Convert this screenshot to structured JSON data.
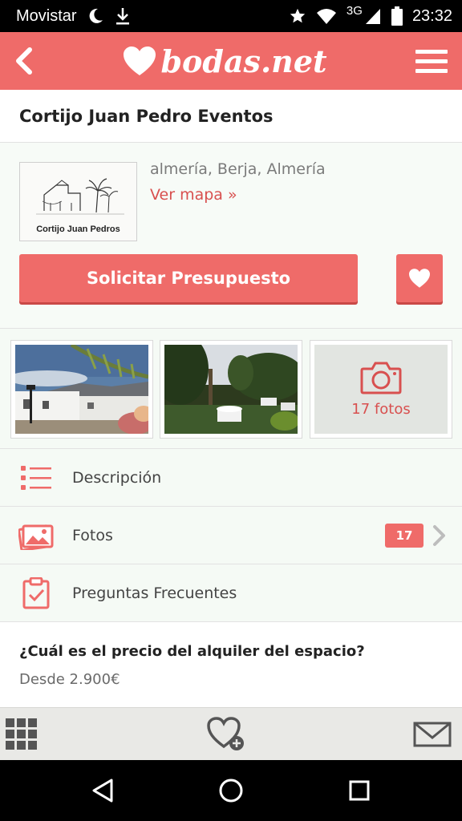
{
  "status_bar": {
    "carrier": "Movistar",
    "network": "3G",
    "time": "23:32",
    "icons": [
      "moon-icon",
      "download-icon",
      "star-icon",
      "wifi-icon",
      "signal-icon",
      "battery-icon"
    ]
  },
  "app_bar": {
    "logo_text": "bodas.net",
    "back_icon": "back-arrow-icon",
    "menu_icon": "hamburger-menu-icon",
    "background_color": "#ef6b69"
  },
  "venue": {
    "title": "Cortijo Juan Pedro Eventos",
    "logo_label": "Cortijo Juan Pedros",
    "location": "almería, Berja, Almería",
    "map_link": "Ver mapa »",
    "quote_button": "Solicitar Presupuesto",
    "favorite_icon": "heart-icon"
  },
  "gallery": {
    "photo_count_label": "17 fotos",
    "camera_icon": "camera-icon"
  },
  "menu": {
    "items": [
      {
        "label": "Descripción",
        "icon": "list-icon"
      },
      {
        "label": "Fotos",
        "icon": "photos-icon",
        "badge": "17"
      },
      {
        "label": "Preguntas Frecuentes",
        "icon": "clipboard-check-icon"
      }
    ]
  },
  "faq": {
    "question": "¿Cuál es el precio del alquiler del espacio?",
    "answer": "Desde 2.900€"
  },
  "bottom_bar": {
    "icons": [
      "grid-icon",
      "heart-plus-icon",
      "mail-icon"
    ]
  },
  "nav_bar": {
    "icons": [
      "back-triangle-icon",
      "home-circle-icon",
      "recents-square-icon"
    ]
  },
  "colors": {
    "accent": "#ef6b69",
    "link": "#d8504f"
  }
}
